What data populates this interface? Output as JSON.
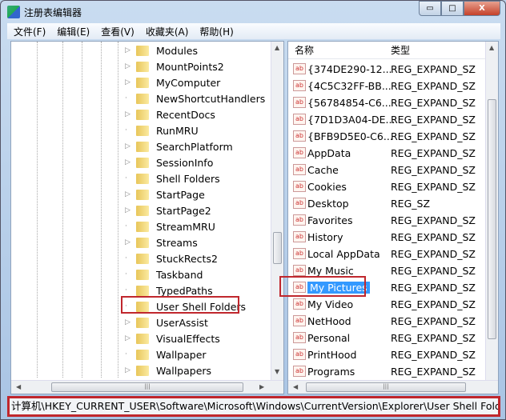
{
  "window": {
    "title": "注册表编辑器",
    "minimize": "▭",
    "maximize": "□",
    "close": "X"
  },
  "menu": [
    "文件(F)",
    "编辑(E)",
    "查看(V)",
    "收藏夹(A)",
    "帮助(H)"
  ],
  "tree": [
    {
      "label": "Modules",
      "expand": true
    },
    {
      "label": "MountPoints2",
      "expand": true
    },
    {
      "label": "MyComputer",
      "expand": true
    },
    {
      "label": "NewShortcutHandlers",
      "expand": false
    },
    {
      "label": "RecentDocs",
      "expand": true
    },
    {
      "label": "RunMRU",
      "expand": false
    },
    {
      "label": "SearchPlatform",
      "expand": true
    },
    {
      "label": "SessionInfo",
      "expand": true
    },
    {
      "label": "Shell Folders",
      "expand": false
    },
    {
      "label": "StartPage",
      "expand": true
    },
    {
      "label": "StartPage2",
      "expand": true
    },
    {
      "label": "StreamMRU",
      "expand": false
    },
    {
      "label": "Streams",
      "expand": true
    },
    {
      "label": "StuckRects2",
      "expand": false
    },
    {
      "label": "Taskband",
      "expand": false
    },
    {
      "label": "TypedPaths",
      "expand": false
    },
    {
      "label": "User Shell Folders",
      "expand": false,
      "highlighted": true
    },
    {
      "label": "UserAssist",
      "expand": true
    },
    {
      "label": "VisualEffects",
      "expand": true
    },
    {
      "label": "Wallpaper",
      "expand": false
    },
    {
      "label": "Wallpapers",
      "expand": true
    }
  ],
  "list": {
    "columns": [
      "名称",
      "类型"
    ],
    "rows": [
      {
        "name": "{374DE290-12...",
        "type": "REG_EXPAND_SZ"
      },
      {
        "name": "{4C5C32FF-BB...",
        "type": "REG_EXPAND_SZ"
      },
      {
        "name": "{56784854-C6...",
        "type": "REG_EXPAND_SZ"
      },
      {
        "name": "{7D1D3A04-DE...",
        "type": "REG_EXPAND_SZ"
      },
      {
        "name": "{BFB9D5E0-C6...",
        "type": "REG_EXPAND_SZ"
      },
      {
        "name": "AppData",
        "type": "REG_EXPAND_SZ"
      },
      {
        "name": "Cache",
        "type": "REG_EXPAND_SZ"
      },
      {
        "name": "Cookies",
        "type": "REG_EXPAND_SZ"
      },
      {
        "name": "Desktop",
        "type": "REG_SZ"
      },
      {
        "name": "Favorites",
        "type": "REG_EXPAND_SZ"
      },
      {
        "name": "History",
        "type": "REG_EXPAND_SZ"
      },
      {
        "name": "Local AppData",
        "type": "REG_EXPAND_SZ"
      },
      {
        "name": "My Music",
        "type": "REG_EXPAND_SZ"
      },
      {
        "name": "My Pictures",
        "type": "REG_EXPAND_SZ",
        "selected": true
      },
      {
        "name": "My Video",
        "type": "REG_EXPAND_SZ"
      },
      {
        "name": "NetHood",
        "type": "REG_EXPAND_SZ"
      },
      {
        "name": "Personal",
        "type": "REG_EXPAND_SZ"
      },
      {
        "name": "PrintHood",
        "type": "REG_EXPAND_SZ"
      },
      {
        "name": "Programs",
        "type": "REG_EXPAND_SZ"
      }
    ]
  },
  "status": "计算机\\HKEY_CURRENT_USER\\Software\\Microsoft\\Windows\\CurrentVersion\\Explorer\\User Shell Folder",
  "colors": {
    "highlight": "#c0272d",
    "selection": "#3399ff"
  }
}
